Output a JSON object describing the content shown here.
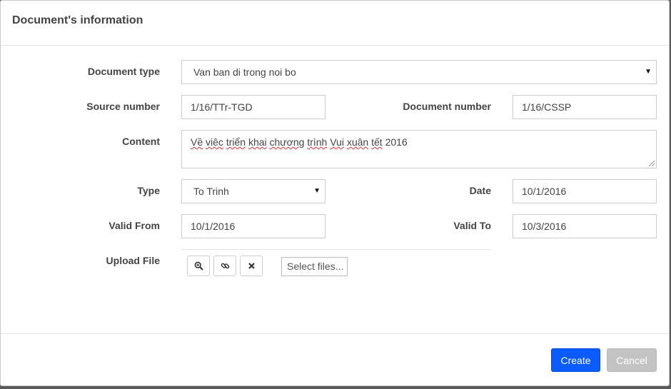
{
  "modal": {
    "title": "Document's information"
  },
  "form": {
    "document_type": {
      "label": "Document type",
      "value": "Van ban di trong noi bo"
    },
    "source_number": {
      "label": "Source number",
      "value": "1/16/TTr-TGD"
    },
    "document_number": {
      "label": "Document number",
      "value": "1/16/CSSP"
    },
    "content": {
      "label": "Content",
      "words": [
        "Về",
        "viêc",
        "triển",
        "khai",
        "chương",
        "trình",
        "Vui",
        "xuân",
        "tết",
        "2016"
      ]
    },
    "type": {
      "label": "Type",
      "value": "To Trinh"
    },
    "date": {
      "label": "Date",
      "value": "10/1/2016"
    },
    "valid_from": {
      "label": "Valid From",
      "value": "10/1/2016"
    },
    "valid_to": {
      "label": "Valid To",
      "value": "10/3/2016"
    },
    "upload": {
      "label": "Upload File",
      "select_files": "Select files..."
    }
  },
  "footer": {
    "create_label": "Create",
    "cancel_label": "Cancel"
  },
  "colors": {
    "primary": "#0a5cff",
    "disabled": "#c3c3c3"
  },
  "icons": [
    "zoom-in-icon",
    "link-icon",
    "remove-icon",
    "dropdown-caret-icon"
  ]
}
